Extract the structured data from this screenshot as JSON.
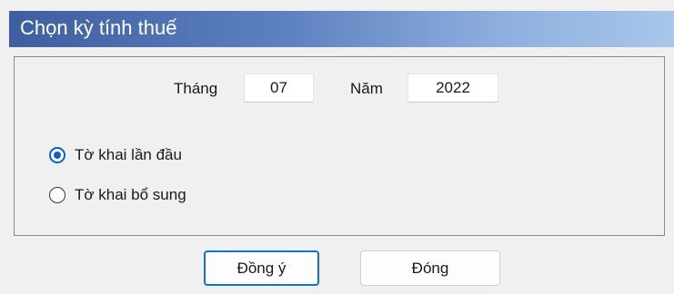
{
  "dialog": {
    "title": "Chọn kỳ tính thuế"
  },
  "period": {
    "month_label": "Tháng",
    "month_value": "07",
    "year_label": "Năm",
    "year_value": "2022"
  },
  "declaration_type": {
    "options": [
      {
        "label": "Tờ khai lần đầu",
        "selected": true
      },
      {
        "label": "Tờ khai bổ sung",
        "selected": false
      }
    ]
  },
  "buttons": {
    "ok_label": "Đồng ý",
    "close_label": "Đóng"
  },
  "colors": {
    "accent": "#0f5fc6",
    "title_bar_start": "#3d5fa0",
    "title_bar_end": "#a9c6ea"
  }
}
